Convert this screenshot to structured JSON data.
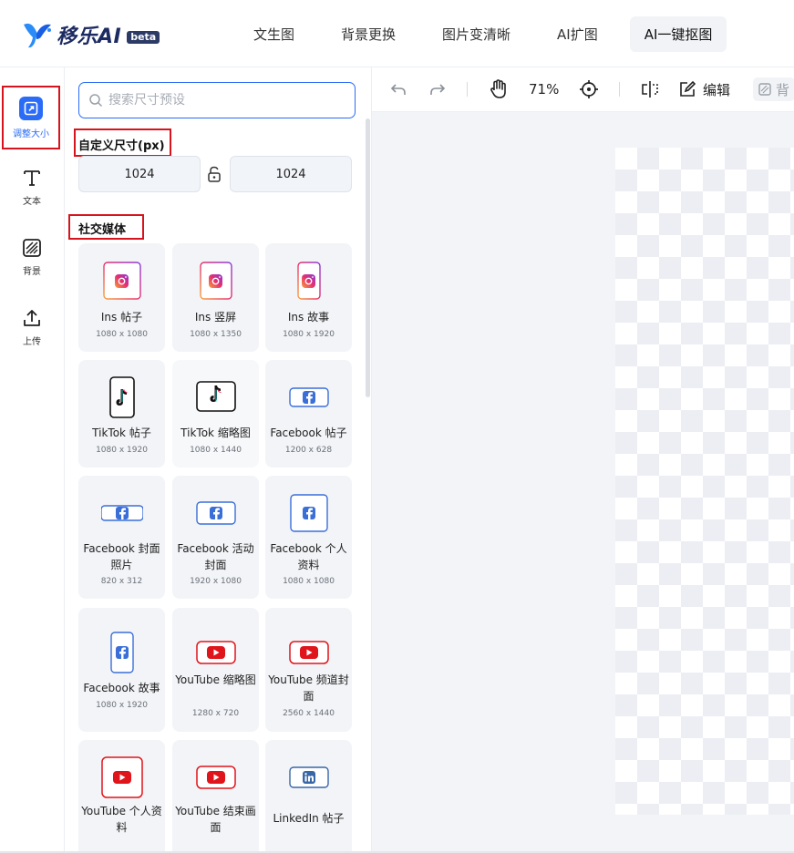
{
  "brand": {
    "name": "移乐AI",
    "badge": "beta"
  },
  "nav": [
    {
      "label": "文生图"
    },
    {
      "label": "背景更换"
    },
    {
      "label": "图片变清晰"
    },
    {
      "label": "AI扩图"
    },
    {
      "label": "AI一键抠图",
      "active": true
    }
  ],
  "rail": [
    {
      "label": "调整大小",
      "icon": "resize-icon",
      "active": true
    },
    {
      "label": "文本",
      "icon": "text-icon"
    },
    {
      "label": "背景",
      "icon": "background-icon"
    },
    {
      "label": "上传",
      "icon": "upload-icon"
    }
  ],
  "panel": {
    "search_placeholder": "搜索尺寸预设",
    "custom_title": "自定义尺寸(px)",
    "width": "1024",
    "height": "1024",
    "social_title": "社交媒体",
    "presets": [
      {
        "name": "Ins 帖子",
        "dim": "1080 x 1080",
        "icon": "instagram-icon"
      },
      {
        "name": "Ins 竖屏",
        "dim": "1080 x 1350",
        "icon": "instagram-icon"
      },
      {
        "name": "Ins 故事",
        "dim": "1080 x 1920",
        "icon": "instagram-icon"
      },
      {
        "name": "TikTok 帖子",
        "dim": "1080 x 1920",
        "icon": "tiktok-icon"
      },
      {
        "name": "TikTok 缩略图",
        "dim": "1080 x 1440",
        "icon": "tiktok-icon"
      },
      {
        "name": "Facebook 帖子",
        "dim": "1200 x 628",
        "icon": "facebook-icon"
      },
      {
        "name": "Facebook 封面照片",
        "dim": "820 x 312",
        "icon": "facebook-icon"
      },
      {
        "name": "Facebook 活动封面",
        "dim": "1920 x 1080",
        "icon": "facebook-icon"
      },
      {
        "name": "Facebook 个人资料",
        "dim": "1080 x 1080",
        "icon": "facebook-icon"
      },
      {
        "name": "Facebook 故事",
        "dim": "1080 x 1920",
        "icon": "facebook-icon"
      },
      {
        "name": "YouTube 缩略图",
        "dim": "1280 x 720",
        "icon": "youtube-icon"
      },
      {
        "name": "YouTube 频道封面",
        "dim": "2560 x 1440",
        "icon": "youtube-icon"
      },
      {
        "name": "YouTube 个人资料",
        "dim": "",
        "icon": "youtube-icon"
      },
      {
        "name": "YouTube 结束画面",
        "dim": "",
        "icon": "youtube-icon"
      },
      {
        "name": "LinkedIn 帖子",
        "dim": "",
        "icon": "linkedin-icon"
      }
    ]
  },
  "toolbar": {
    "zoom": "71%",
    "edit_label": "编辑",
    "bg_label": "背"
  },
  "colors": {
    "accent": "#2b6cf6",
    "highlight_box": "#d7141d",
    "youtube": "#e0141b",
    "facebook": "#3b6fd8"
  }
}
